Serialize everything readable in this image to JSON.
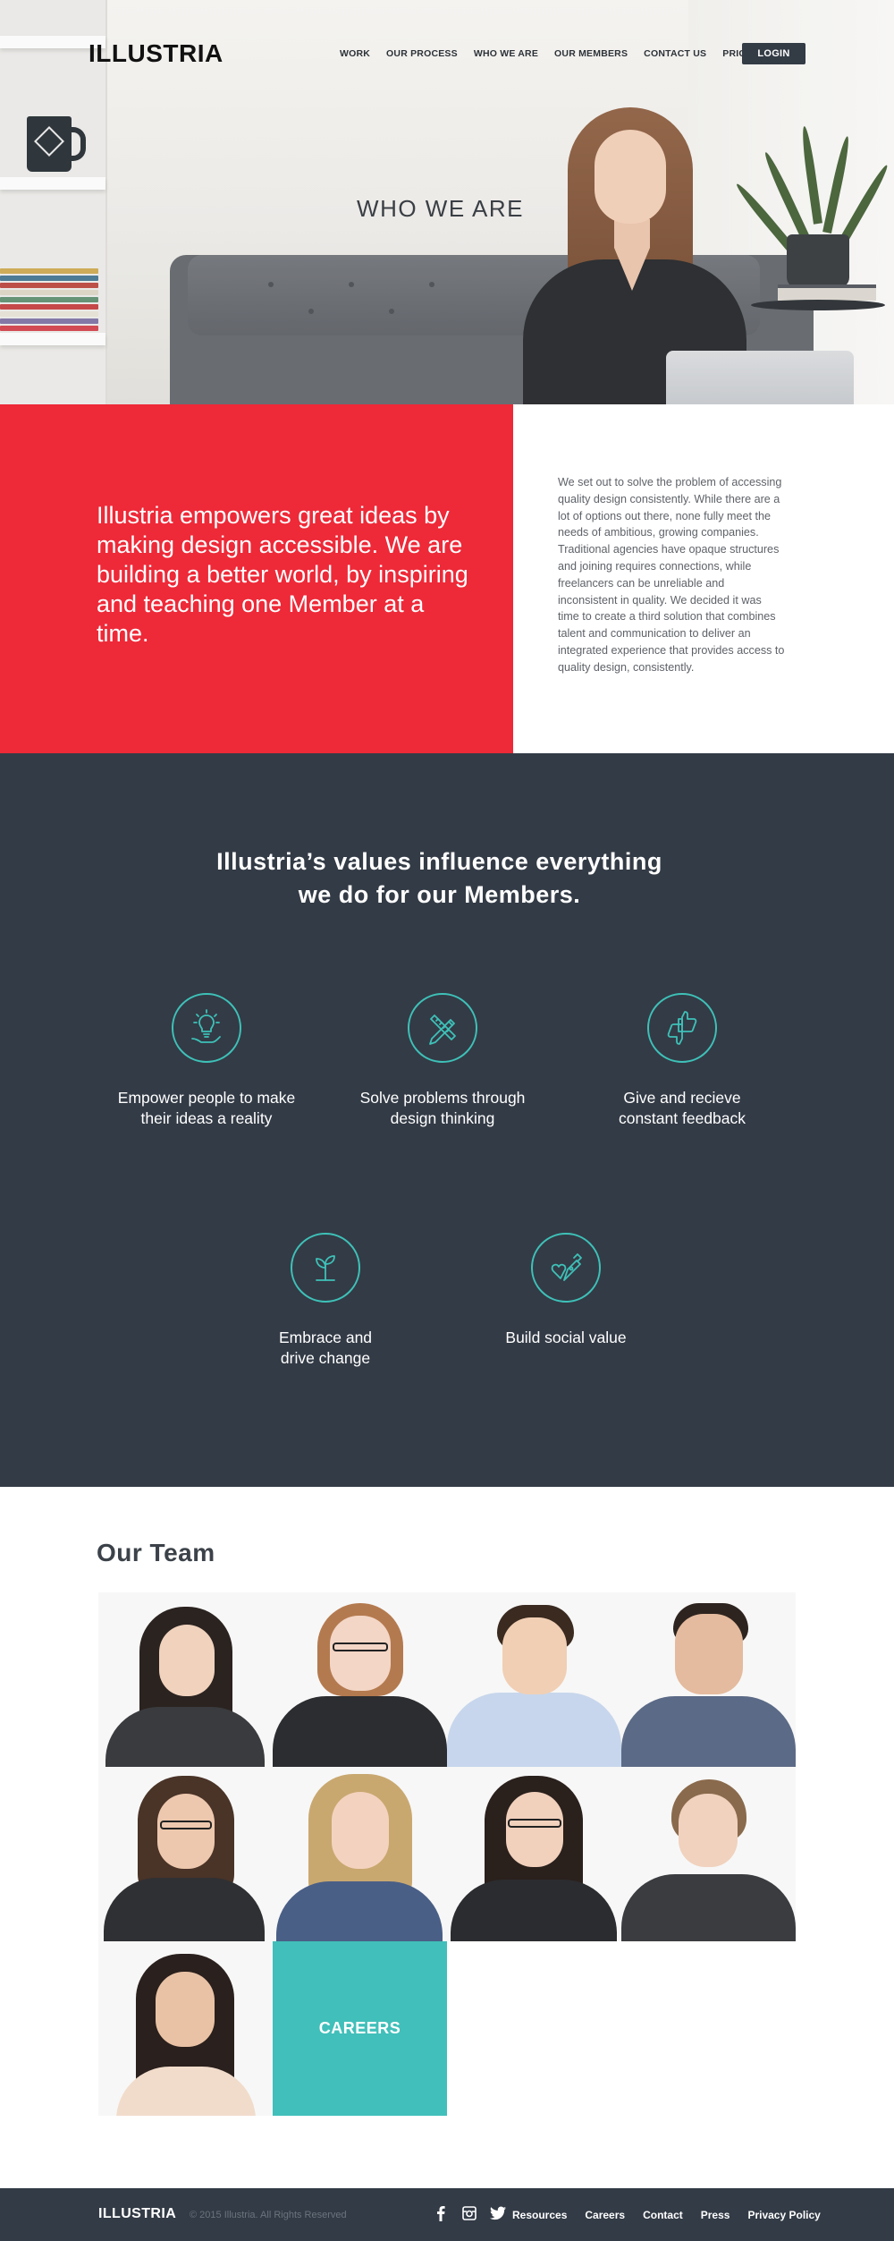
{
  "header": {
    "logo": "ILLUSTRIA",
    "nav": [
      "WORK",
      "OUR PROCESS",
      "WHO WE ARE",
      "OUR MEMBERS",
      "CONTACT US",
      "PRICING"
    ],
    "login": "LOGIN"
  },
  "hero": {
    "title": "WHO WE ARE"
  },
  "mission": {
    "statement": "Illustria empowers great ideas by making design accessible. We are building a better world, by inspiring and teaching one Member at a time.",
    "body": "We set out to solve the problem of accessing quality design consistently. While there are a lot of options out there, none fully meet the needs of ambitious, growing companies. Traditional agencies have opaque structures and joining requires connections, while freelancers can be unreliable and inconsistent in quality. We decided it was time to create a third solution that combines talent and communication to deliver an integrated experience that provides access to quality design, consistently.",
    "accent_color": "#ee2938"
  },
  "values": {
    "heading_line1": "Illustria’s values influence everything",
    "heading_line2": "we do for our Members.",
    "items": [
      {
        "icon": "lightbulb-hand-icon",
        "line1": "Empower people to make",
        "line2": "their ideas a reality"
      },
      {
        "icon": "pencil-ruler-icon",
        "line1": "Solve problems through",
        "line2": "design thinking"
      },
      {
        "icon": "thumbs-up-down-icon",
        "line1": "Give and recieve",
        "line2": "constant feedback"
      },
      {
        "icon": "sprout-icon",
        "line1": "Embrace and",
        "line2": "drive change"
      },
      {
        "icon": "heart-pen-icon",
        "line1": "Build social value",
        "line2": ""
      }
    ],
    "bg_color": "#333b46",
    "icon_color": "#3ec1b8"
  },
  "team": {
    "title": "Our Team",
    "careers": "CAREERS",
    "careers_color": "#41bfba"
  },
  "footer": {
    "logo": "ILLUSTRIA",
    "copyright": "© 2015 Illustria. All Rights Reserved",
    "social": [
      "facebook-icon",
      "instagram-icon",
      "twitter-icon"
    ],
    "links": [
      "Resources",
      "Careers",
      "Contact",
      "Press",
      "Privacy Policy"
    ]
  }
}
